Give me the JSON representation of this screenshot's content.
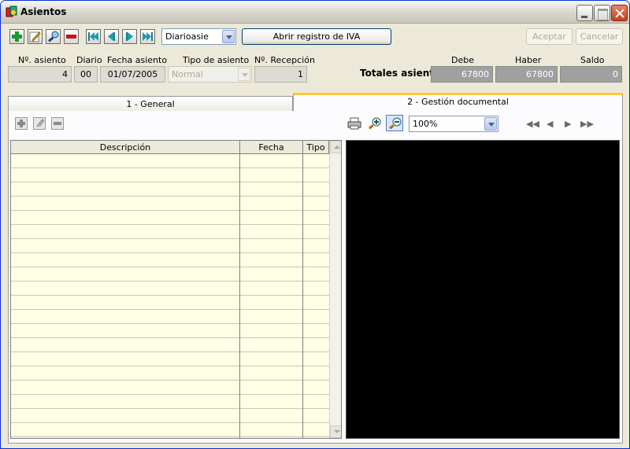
{
  "window": {
    "title": "Asientos"
  },
  "toolbar": {
    "diary_select": "Diarioasie",
    "vat_button": "Abrir registro de IVA",
    "accept": "Aceptar",
    "cancel": "Cancelar",
    "icons": [
      "add-icon",
      "edit-icon",
      "search-icon",
      "delete-icon",
      "first-icon",
      "prev-icon",
      "next-icon",
      "last-icon"
    ]
  },
  "header": {
    "labels": {
      "entry_no": "Nº. asiento",
      "diary": "Diario",
      "date": "Fecha asiento",
      "type": "Tipo de asiento",
      "reception": "Nº. Recepción",
      "totals": "Totales asiento",
      "debit": "Debe",
      "credit": "Haber",
      "balance": "Saldo"
    },
    "values": {
      "entry_no": "4",
      "diary": "00",
      "date": "01/07/2005",
      "type": "Normal",
      "reception": "1",
      "debit": "67800",
      "credit": "67800",
      "balance": "0"
    }
  },
  "tabs": [
    {
      "label": "1 - General"
    },
    {
      "label": "2 - Gestión documental"
    }
  ],
  "documents": {
    "zoom": "100%",
    "columns": [
      "Descripción",
      "Fecha",
      "Tipo"
    ],
    "rows": []
  },
  "colors": {
    "accent": "#ffc83c",
    "viewer": "#000000"
  }
}
